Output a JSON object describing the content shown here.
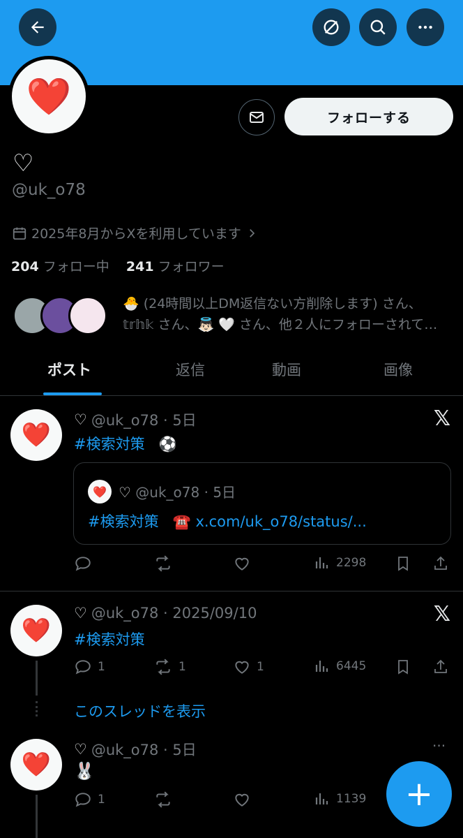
{
  "header": {
    "back_icon": "arrow-left-icon",
    "grok_icon": "grok-icon",
    "search_icon": "search-icon",
    "more_icon": "more-icon",
    "banner_color": "#1d9bf0"
  },
  "profile": {
    "avatar_emoji": "❤️",
    "display_name_emoji": "♡",
    "handle": "@uk_o78",
    "joined": "2025年8月からXを利用しています",
    "following_count": "204",
    "following_label": "フォロー中",
    "followers_count": "241",
    "followers_label": "フォロワー",
    "follow_button": "フォローする",
    "known_followers_line1": "🐣 (24時間以上DM返信ない方削除します) さん、",
    "known_followers_line2": "𝕥𝕣𝕙𝕜 さん、👼🏻 🤍 さん、他２人にフォローされて…"
  },
  "tabs": [
    {
      "label": "ポスト",
      "active": true
    },
    {
      "label": "返信",
      "active": false
    },
    {
      "label": "動画",
      "active": false
    },
    {
      "label": "画像",
      "active": false
    }
  ],
  "posts": [
    {
      "name": "♡",
      "handle_time": "@uk_o78 · 5日",
      "text": "#検索対策",
      "emoji": "⚽",
      "quote": {
        "handle_time": "@uk_o78 · 5日",
        "text": "#検索対策",
        "emoji": "☎️",
        "link": "x.com/uk_o78/status/..."
      },
      "replies": "",
      "reposts": "",
      "likes": "",
      "views": "2298"
    },
    {
      "name": "♡",
      "handle_time": "@uk_o78 · 2025/09/10",
      "text": "#検索対策",
      "replies": "1",
      "reposts": "1",
      "likes": "1",
      "views": "6445",
      "thread_link": "このスレッドを表示"
    },
    {
      "name": "♡",
      "handle_time": "@uk_o78 · 5日",
      "text": "🐰",
      "replies": "1",
      "reposts": "",
      "likes": "",
      "views": "1139"
    }
  ],
  "fab_label": "+"
}
